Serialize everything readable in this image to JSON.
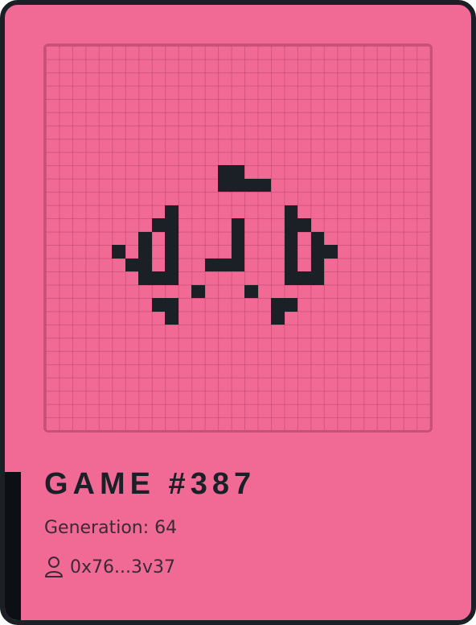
{
  "card": {
    "title": "GAME #387",
    "generation_text": "Generation: 64",
    "owner_address": "0x76...3v37",
    "owner_icon": "user-icon"
  },
  "board": {
    "columns": 29,
    "rows": 29,
    "live_color": "#1B1F26",
    "background_color": "#F06A95",
    "live_cells": [
      [
        13,
        9
      ],
      [
        14,
        9
      ],
      [
        13,
        10
      ],
      [
        14,
        10
      ],
      [
        15,
        10
      ],
      [
        16,
        10
      ],
      [
        9,
        12
      ],
      [
        18,
        12
      ],
      [
        8,
        13
      ],
      [
        9,
        13
      ],
      [
        14,
        13
      ],
      [
        18,
        13
      ],
      [
        19,
        13
      ],
      [
        7,
        14
      ],
      [
        9,
        14
      ],
      [
        14,
        14
      ],
      [
        18,
        14
      ],
      [
        20,
        14
      ],
      [
        5,
        15
      ],
      [
        7,
        15
      ],
      [
        9,
        15
      ],
      [
        14,
        15
      ],
      [
        18,
        15
      ],
      [
        20,
        15
      ],
      [
        21,
        15
      ],
      [
        6,
        16
      ],
      [
        7,
        16
      ],
      [
        9,
        16
      ],
      [
        12,
        16
      ],
      [
        13,
        16
      ],
      [
        14,
        16
      ],
      [
        18,
        16
      ],
      [
        20,
        16
      ],
      [
        7,
        17
      ],
      [
        8,
        17
      ],
      [
        9,
        17
      ],
      [
        18,
        17
      ],
      [
        19,
        17
      ],
      [
        20,
        17
      ],
      [
        11,
        18
      ],
      [
        15,
        18
      ],
      [
        8,
        19
      ],
      [
        9,
        19
      ],
      [
        17,
        19
      ],
      [
        18,
        19
      ],
      [
        9,
        20
      ],
      [
        17,
        20
      ]
    ]
  }
}
